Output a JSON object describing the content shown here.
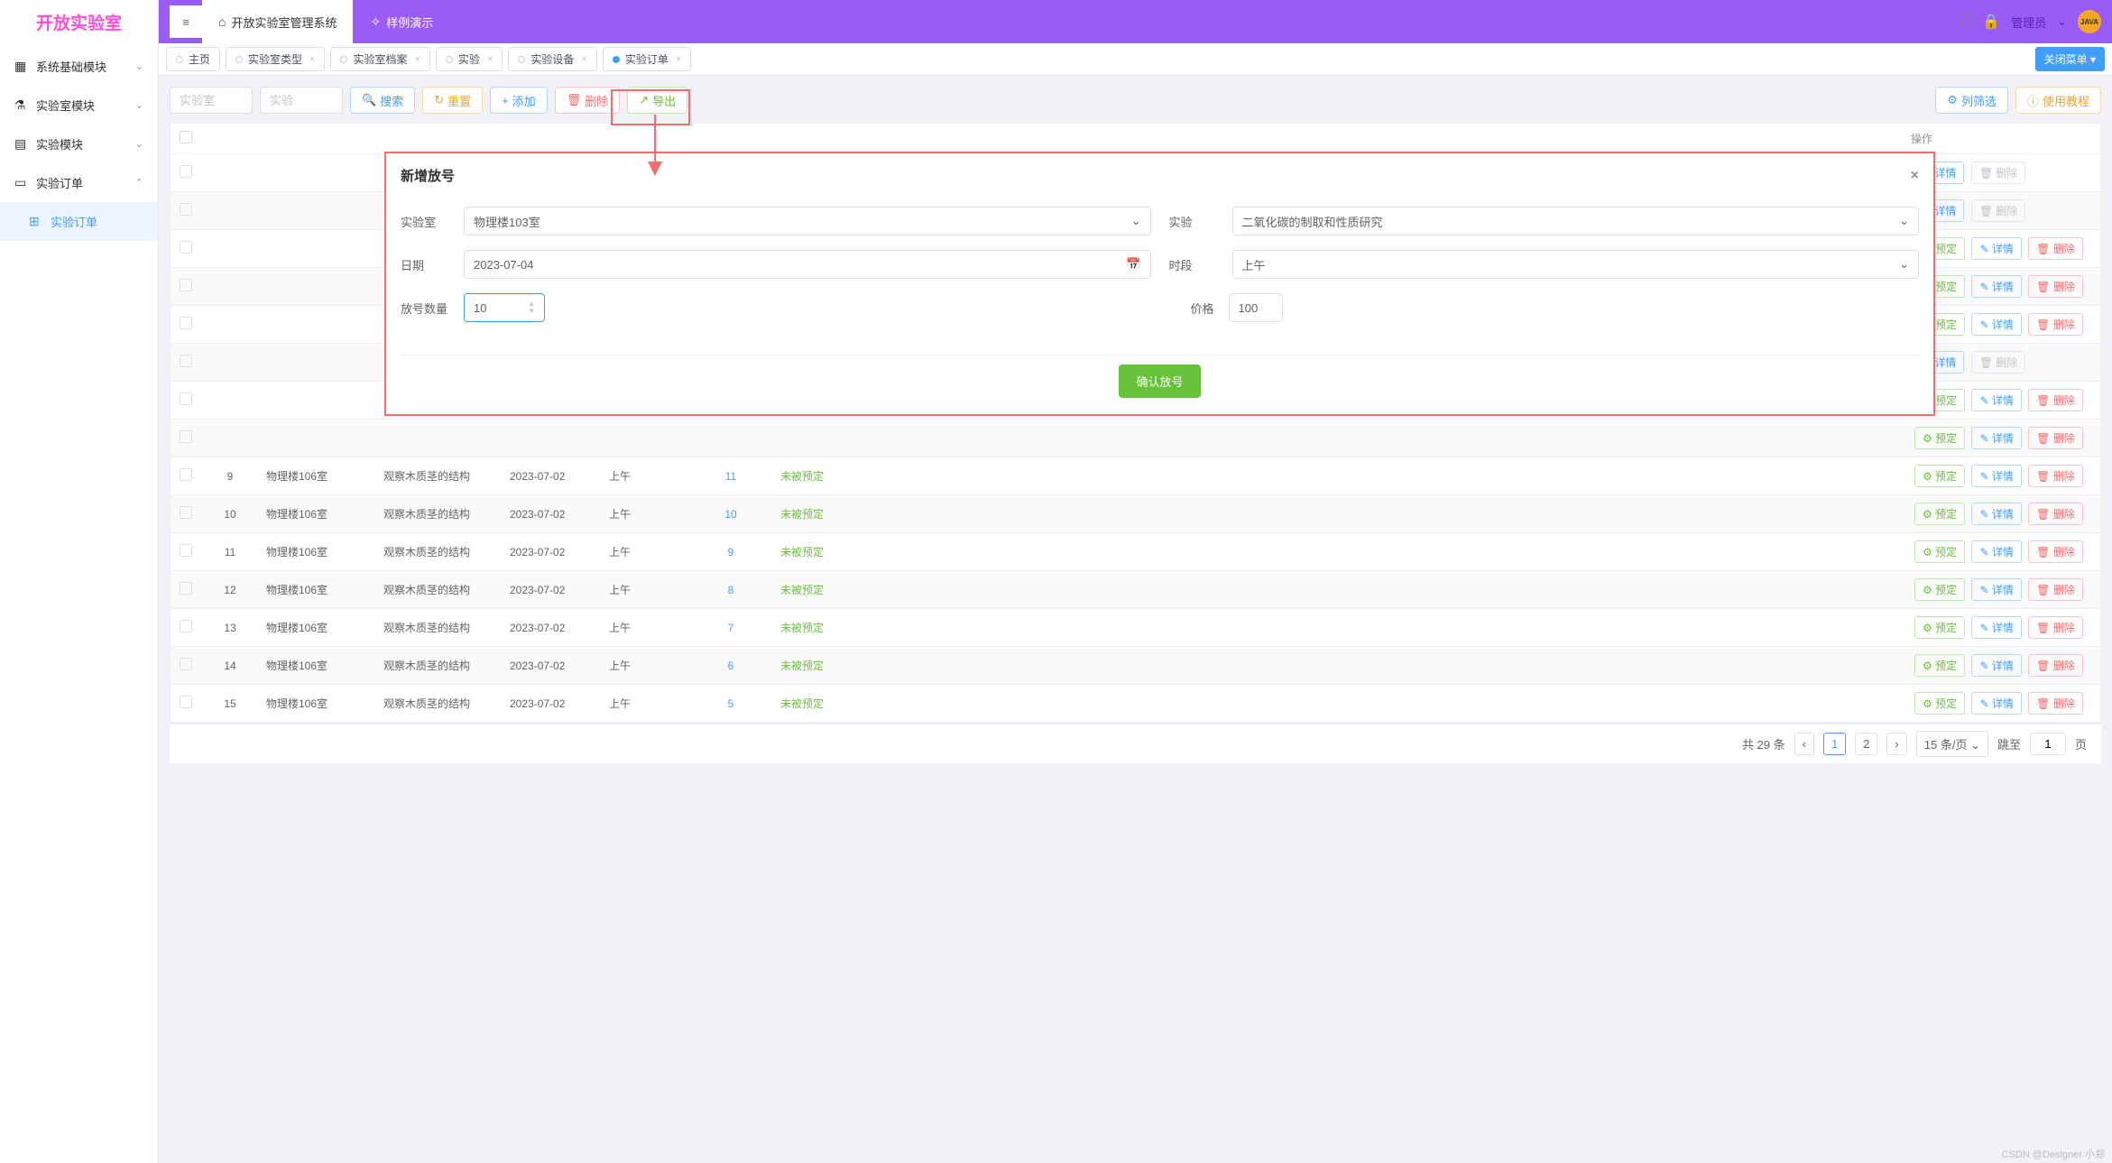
{
  "logo": "开放实验室",
  "sidebar": {
    "items": [
      {
        "label": "系统基础模块",
        "icon": "⚙",
        "expanded": false
      },
      {
        "label": "实验室模块",
        "icon": "🧪",
        "expanded": false
      },
      {
        "label": "实验模块",
        "icon": "📋",
        "expanded": false
      },
      {
        "label": "实验订单",
        "icon": "📄",
        "expanded": true
      },
      {
        "label": "实验订单",
        "icon": "🛒",
        "active": true,
        "sub": true
      }
    ]
  },
  "topbar": {
    "tabs": [
      {
        "label": "开放实验室管理系统",
        "icon": "⌂"
      },
      {
        "label": "样例演示",
        "icon": "✨"
      }
    ],
    "user": "管理员",
    "badge": "JAVA"
  },
  "pageTabs": {
    "items": [
      {
        "label": "主页"
      },
      {
        "label": "实验室类型"
      },
      {
        "label": "实验室档案"
      },
      {
        "label": "实验"
      },
      {
        "label": "实验设备"
      },
      {
        "label": "实验订单",
        "active": true
      }
    ],
    "closeMenu": "关闭菜单"
  },
  "toolbar": {
    "labPlaceholder": "实验室",
    "expPlaceholder": "实验",
    "search": "搜索",
    "reset": "重置",
    "add": "添加",
    "delete": "删除",
    "export": "导出",
    "filter": "列筛选",
    "tutorial": "使用教程"
  },
  "table": {
    "opHeader": "操作",
    "reserve": "预定",
    "detail": "详情",
    "delete": "删除",
    "rows": [
      {
        "id": "9",
        "room": "物理楼106室",
        "exp": "观察木质茎的结构",
        "date": "2023-07-02",
        "period": "上午",
        "count": "11",
        "status": "未被预定",
        "deleteDisabled": false,
        "reserveShown": true
      },
      {
        "id": "10",
        "room": "物理楼106室",
        "exp": "观察木质茎的结构",
        "date": "2023-07-02",
        "period": "上午",
        "count": "10",
        "status": "未被预定",
        "deleteDisabled": false,
        "reserveShown": true
      },
      {
        "id": "11",
        "room": "物理楼106室",
        "exp": "观察木质茎的结构",
        "date": "2023-07-02",
        "period": "上午",
        "count": "9",
        "status": "未被预定",
        "deleteDisabled": false,
        "reserveShown": true
      },
      {
        "id": "12",
        "room": "物理楼106室",
        "exp": "观察木质茎的结构",
        "date": "2023-07-02",
        "period": "上午",
        "count": "8",
        "status": "未被预定",
        "deleteDisabled": false,
        "reserveShown": true
      },
      {
        "id": "13",
        "room": "物理楼106室",
        "exp": "观察木质茎的结构",
        "date": "2023-07-02",
        "period": "上午",
        "count": "7",
        "status": "未被预定",
        "deleteDisabled": false,
        "reserveShown": true
      },
      {
        "id": "14",
        "room": "物理楼106室",
        "exp": "观察木质茎的结构",
        "date": "2023-07-02",
        "period": "上午",
        "count": "6",
        "status": "未被预定",
        "deleteDisabled": false,
        "reserveShown": true
      },
      {
        "id": "15",
        "room": "物理楼106室",
        "exp": "观察木质茎的结构",
        "date": "2023-07-02",
        "period": "上午",
        "count": "5",
        "status": "未被预定",
        "deleteDisabled": false,
        "reserveShown": true
      }
    ],
    "hiddenRows": 8
  },
  "pagination": {
    "total": "共 29 条",
    "pages": [
      "1",
      "2"
    ],
    "perPage": "15 条/页",
    "jumpLabel": "跳至",
    "jumpValue": "1",
    "pageSuffix": "页"
  },
  "modal": {
    "title": "新增放号",
    "labLabel": "实验室",
    "labValue": "物理楼103室",
    "expLabel": "实验",
    "expValue": "二氧化碳的制取和性质研究",
    "dateLabel": "日期",
    "dateValue": "2023-07-04",
    "periodLabel": "时段",
    "periodValue": "上午",
    "countLabel": "放号数量",
    "countValue": "10",
    "priceLabel": "价格",
    "priceValue": "100",
    "confirm": "确认放号"
  },
  "watermark": "CSDN @Designer 小郑"
}
